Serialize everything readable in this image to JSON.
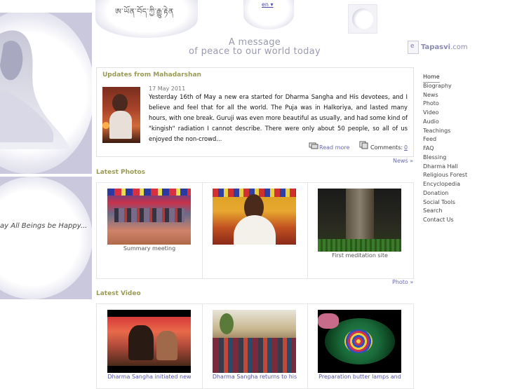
{
  "header": {
    "script_banner": "ཨ་ཡོན་བོད་ཀྱི་རྒྱུ་རྟེན",
    "language": "en ▾",
    "message_line1": "A message",
    "message_line2": "of peace to our world today",
    "brand_name": "Tapasvi",
    "brand_domain": ".com"
  },
  "left": {
    "tagline": "ay All Beings be Happy..."
  },
  "updates": {
    "title": "Updates from Mahadarshan",
    "date": "17 May 2011",
    "text": "Yesterday 16th of May a new era started for Dharma Sangha and His devotees, and I believe and feel that for all the world. The Puja was in Halkoriya, and lasted many hours, with one break. Guruji was even more beautiful as usually, and had some kind of \"kingish\" radiation I cannot describe. There were only about 50 people, so all of us enjoyed the non-crowd...",
    "read_more": "Read more",
    "comments_label": "Comments:",
    "comments_count": "0",
    "news_link": "News »"
  },
  "photos": {
    "title": "Latest Photos",
    "items": [
      {
        "caption": "Summary meeting"
      },
      {
        "caption": ""
      },
      {
        "caption": "First meditation site"
      }
    ],
    "more_link": "Photo »"
  },
  "videos": {
    "title": "Latest Video",
    "items": [
      {
        "caption": "Dharma Sangha initiated new"
      },
      {
        "caption": "Dharma Sangha returns to his"
      },
      {
        "caption": "Preparation butter lamps and"
      }
    ]
  },
  "nav": {
    "items": [
      "Home",
      "Biography",
      "News",
      "Photo",
      "Video",
      "Audio",
      "Teachings",
      "Feed",
      "FAQ",
      "Blessing",
      "Dharma Hall",
      "Religious Forest",
      "Encyclopedia",
      "Donation",
      "Social Tools",
      "Search",
      "Contact Us"
    ]
  },
  "icons": [
    "read-more-icon",
    "comments-icon",
    "brand-logo-icon"
  ],
  "colors": {
    "section_title": "#9a9a55",
    "link": "#6a6ab0",
    "message": "#9a9ab0",
    "panel": "#c9c8dc"
  }
}
